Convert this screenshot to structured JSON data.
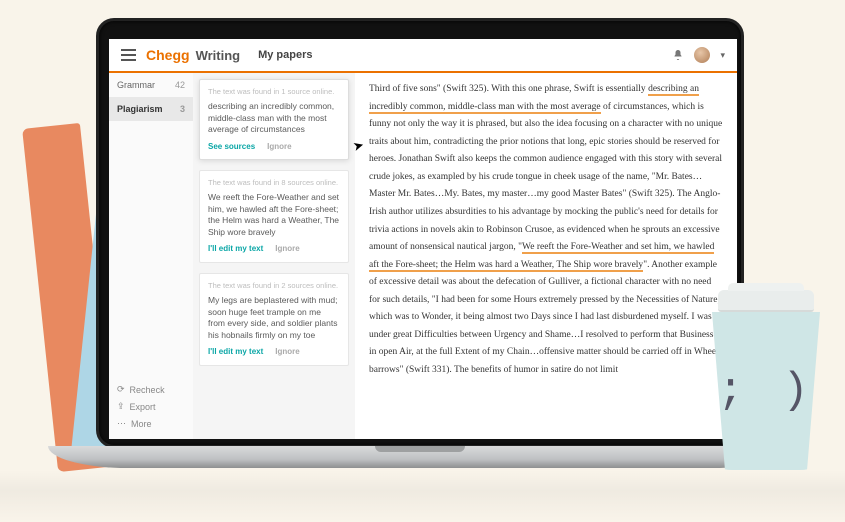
{
  "header": {
    "logo_brand": "Chegg",
    "logo_product": "Writing",
    "nav_mypapers": "My papers"
  },
  "sidebar": {
    "items": [
      {
        "label": "Grammar",
        "count": "42"
      },
      {
        "label": "Plagiarism",
        "count": "3"
      }
    ],
    "actions": {
      "recheck": "Recheck",
      "export": "Export",
      "more": "More"
    }
  },
  "cards": [
    {
      "source": "The text was found in 1 source online.",
      "text": "describing an incredibly common, middle-class man with the most average of circumstances",
      "action_primary": "See sources",
      "action_secondary": "Ignore"
    },
    {
      "source": "The text was found in 8 sources online.",
      "text": "We reeft the Fore-Weather and  set him, we hawled aft the Fore-sheet; the Helm was hard a Weather, The Ship wore bravely",
      "action_primary": "I'll edit my text",
      "action_secondary": "Ignore"
    },
    {
      "source": "The text was found in 2 sources online.",
      "text": "My legs are beplastered with mud; soon huge feet trample on me from every side, and soldier plants his hobnails firmly on my toe",
      "action_primary": "I'll edit my text",
      "action_secondary": "Ignore"
    }
  ],
  "document": {
    "t1a": "Third of five sons\" (Swift 325). With this one phrase, Swift is essentially ",
    "t1b": "describing an incredibly common, middle-class man with the most average",
    "t1c": " of circumstances, which is funny not only the way it is phrased, but also the idea focusing on a character with no unique traits about him, contradicting the prior notions that long, epic stories should be reserved for heroes. Jonathan Swift also keeps the common audience engaged with this story with several crude jokes, as exampled by his crude tongue in cheek usage of the name, \"Mr. Bates…Master Mr. Bates…My. Bates, my master…my good Master Bates\" (Swift 325). The Anglo-Irish author utilizes absurdities to his advantage by mocking the public's need for details for trivia actions in novels akin to Robinson Crusoe, as evidenced when he sprouts an excessive amount of nonsensical nautical jargon, \"",
    "t1d": "We reeft the Fore-Weather and  set him, we hawled aft the Fore-sheet; the Helm was hard a Weather, The Ship wore bravely",
    "t1e": "\". Another example of excessive detail was about the defecation of Gulliver, a fictional character with no need for such details, \"I had been for some Hours extremely pressed by the Necessities of Nature; which was to Wonder, it being almost two Days since I had last disburdened myself. I was under great Difficulties between Urgency and Shame…I resolved to perform that Business in open Air, at the full Extent of my Chain…offensive matter should be carried off in Wheel-barrows\" (Swift 331). The benefits of humor in satire do not limit"
  },
  "cup_face": "; )"
}
